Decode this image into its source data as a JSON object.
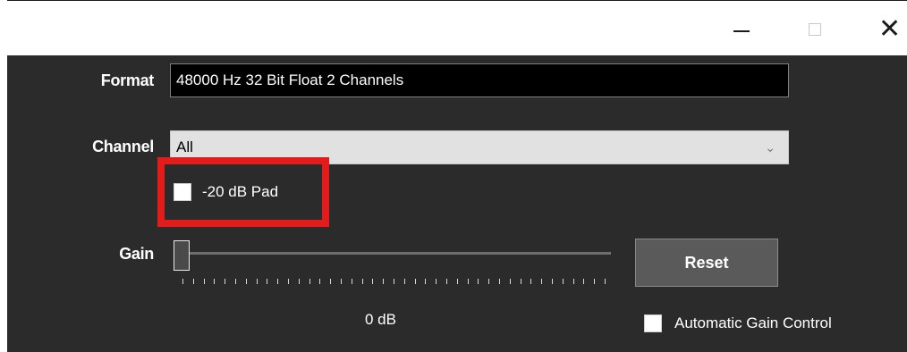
{
  "window": {
    "minimize_icon": "minimize-icon",
    "maximize_icon": "maximize-icon",
    "close_icon": "close-icon",
    "close_glyph": "✕"
  },
  "format": {
    "label": "Format",
    "value": "48000 Hz 32 Bit Float 2 Channels"
  },
  "channel": {
    "label": "Channel",
    "selected": "All",
    "chevron_glyph": "⌄"
  },
  "pad": {
    "label": "-20 dB Pad",
    "checked": false
  },
  "gain": {
    "label": "Gain",
    "value_text": "0 dB",
    "slider_level": 0
  },
  "reset": {
    "label": "Reset"
  },
  "agc": {
    "label": "Automatic Gain Control",
    "checked": false
  },
  "colors": {
    "panel_bg": "#2b2b2b",
    "highlight": "#e21b1b",
    "button_bg": "#5a5a5a"
  }
}
